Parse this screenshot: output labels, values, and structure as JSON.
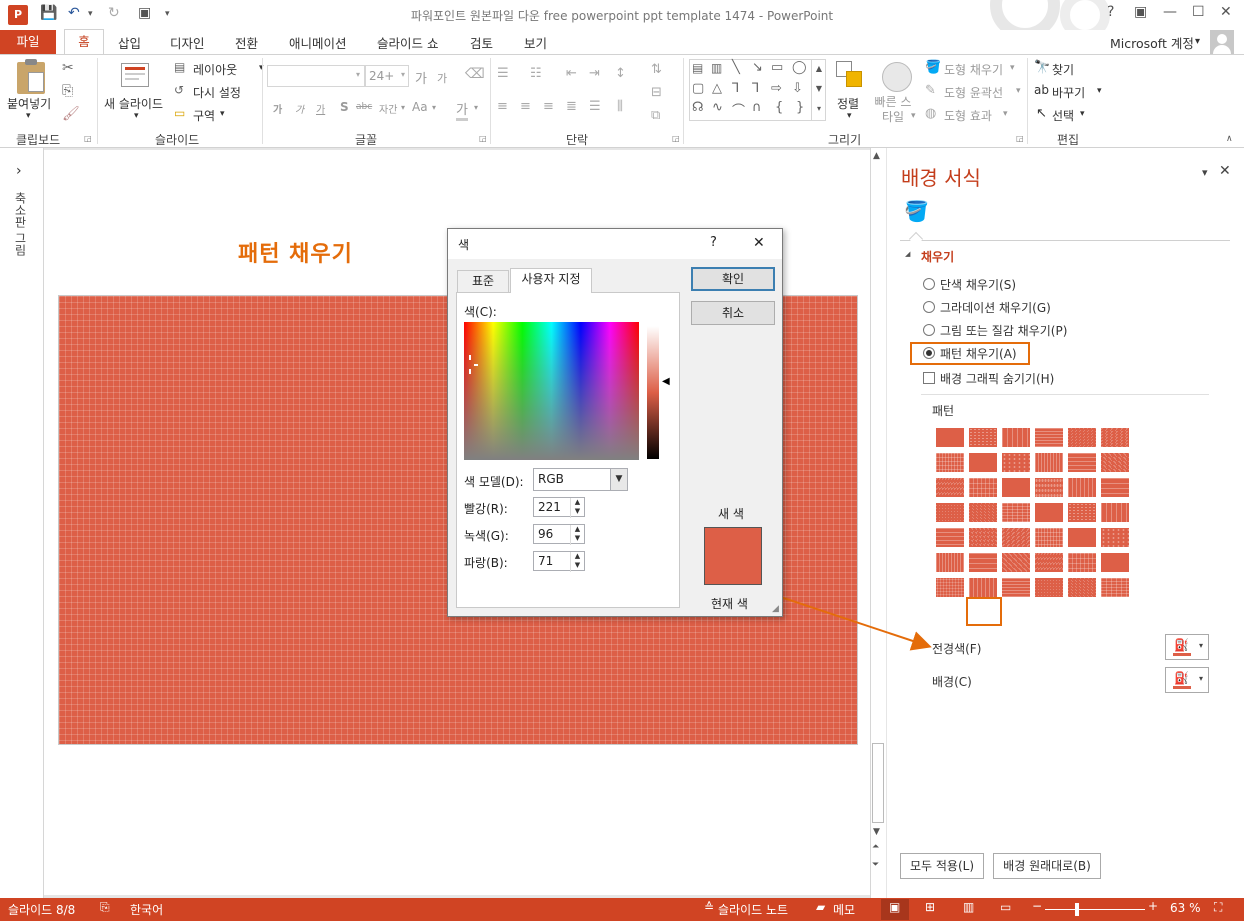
{
  "window": {
    "title": "파워포인트 원본파일 다운 free powerpoint ppt template 1474 - PowerPoint",
    "help_glyph": "?",
    "controls": [
      "▣",
      "—",
      "☐",
      "✕"
    ],
    "account_label": "Microsoft 계정",
    "account_arrow": "▾",
    "qat_more": "▾"
  },
  "ribbon_tabs": [
    "파일",
    "홈",
    "삽입",
    "디자인",
    "전환",
    "애니메이션",
    "슬라이드 쇼",
    "검토",
    "보기"
  ],
  "ribbon": {
    "clipboard": {
      "paste_label": "붙여넣기",
      "dropdown": "▾",
      "group": "클립보드"
    },
    "slides": {
      "new_slide": "새 슬라이드",
      "layout": "레이아웃",
      "reset": "다시 설정",
      "section": "구역",
      "arrow": "▾",
      "group": "슬라이드"
    },
    "font": {
      "size": "24+",
      "grow": "가",
      "shrink": "가",
      "styles": [
        "가",
        "가",
        "가",
        "S",
        "abc",
        "자간",
        "Aa",
        "가"
      ],
      "arrow": "▾",
      "group": "글꼴"
    },
    "paragraph": {
      "group": "단락"
    },
    "drawing": {
      "arrange": "정렬",
      "quick_styles": "빠른 스타일",
      "shape_fill": "도형 채우기",
      "shape_outline": "도형 윤곽선",
      "shape_effects": "도형 효과",
      "group": "그리기"
    },
    "editing": {
      "find": "찾기",
      "replace": "바꾸기",
      "select": "선택",
      "group": "편집"
    }
  },
  "thumb_pane": {
    "label": "축소판 그림",
    "expand": "›"
  },
  "slide": {
    "title": "패턴 채우기"
  },
  "color_dialog": {
    "title": "색",
    "help": "?",
    "close": "✕",
    "tabs": [
      "표준",
      "사용자 지정"
    ],
    "color_label": "색(C):",
    "model_label": "색 모델(D):",
    "model_value": "RGB",
    "red_label": "빨강(R):",
    "red_value": "221",
    "green_label": "녹색(G):",
    "green_value": "96",
    "blue_label": "파랑(B):",
    "blue_value": "71",
    "ok": "확인",
    "cancel": "취소",
    "new_label": "새 색",
    "current_label": "현재 색",
    "new_color": "#dd5f47",
    "current_color": "#dd5f47"
  },
  "task_pane": {
    "title": "배경 서식",
    "pin": "▾",
    "close": "✕",
    "section": "채우기",
    "section_arrow": "◢",
    "fill_options": [
      "단색 채우기(S)",
      "그라데이션 채우기(G)",
      "그림 또는 질감 채우기(P)",
      "패턴 채우기(A)"
    ],
    "selected_fill": "패턴 채우기(A)",
    "hide_graphics": "배경 그래픽 숨기기(H)",
    "pattern_label": "패턴",
    "foreground_label": "전경색(F)",
    "background_label": "배경(C)",
    "apply_all": "모두 적용(L)",
    "reset_bg": "배경 원래대로(B)",
    "accent": "#dd5f47",
    "highlight": "#e46c0a"
  },
  "statusbar": {
    "slide_info": "슬라이드 8/8",
    "language": "한국어",
    "notes": "슬라이드 노트",
    "comments": "메모",
    "zoom_out": "−",
    "zoom_in": "+",
    "zoom": "63 %",
    "zoom_level": 0.63
  }
}
